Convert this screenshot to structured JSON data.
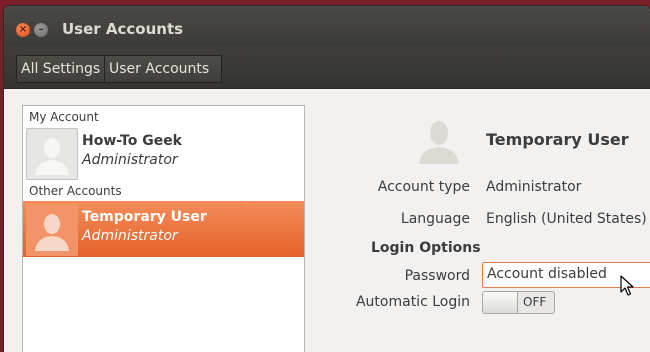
{
  "window": {
    "title": "User Accounts"
  },
  "toolbar": {
    "all_settings": "All Settings",
    "user_accounts": "User Accounts"
  },
  "accounts": {
    "my_account_label": "My Account",
    "other_accounts_label": "Other Accounts",
    "items": [
      {
        "name": "How-To Geek",
        "role": "Administrator",
        "selected": false
      },
      {
        "name": "Temporary User",
        "role": "Administrator",
        "selected": true
      }
    ]
  },
  "detail": {
    "user_name": "Temporary User",
    "account_type_label": "Account type",
    "account_type_value": "Administrator",
    "language_label": "Language",
    "language_value": "English (United States)",
    "login_options_label": "Login Options",
    "password_label": "Password",
    "password_value": "Account disabled",
    "automatic_login_label": "Automatic Login",
    "automatic_login_state": "OFF"
  },
  "colors": {
    "accent": "#e6622a",
    "titlebar": "#3c3b37",
    "background": "#f2f1f0"
  }
}
